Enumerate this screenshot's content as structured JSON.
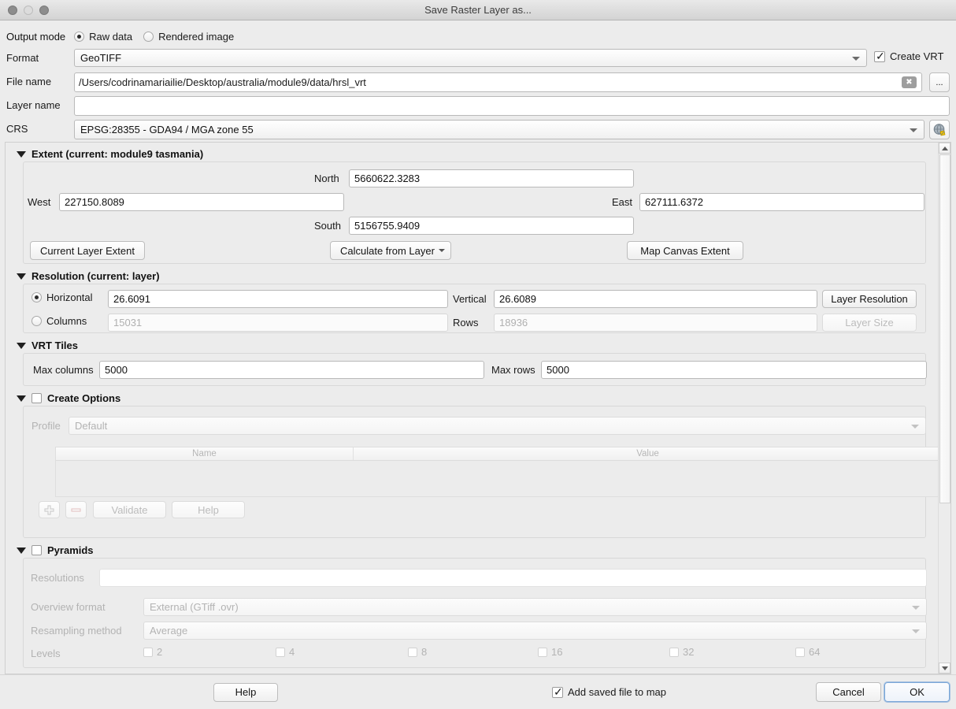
{
  "window": {
    "title": "Save Raster Layer as...",
    "controls": [
      "close",
      "minimize",
      "zoom"
    ]
  },
  "header": {
    "output_mode_label": "Output mode",
    "output_modes": [
      {
        "label": "Raw data",
        "selected": true
      },
      {
        "label": "Rendered image",
        "selected": false
      }
    ],
    "format_label": "Format",
    "format_value": "GeoTIFF",
    "create_vrt_label": "Create VRT",
    "create_vrt_checked": true,
    "file_name_label": "File name",
    "file_name_value": "/Users/codrinamariailie/Desktop/australia/module9/data/hrsl_vrt",
    "clear_icon": "clear-icon",
    "browse_label": "...",
    "layer_name_label": "Layer name",
    "layer_name_value": "",
    "crs_label": "CRS",
    "crs_value": "EPSG:28355 - GDA94 / MGA zone 55",
    "crs_select_icon": "globe-icon"
  },
  "extent": {
    "title": "Extent (current: module9 tasmania)",
    "north_label": "North",
    "north_value": "5660622.3283",
    "west_label": "West",
    "west_value": "227150.8089",
    "east_label": "East",
    "east_value": "627111.6372",
    "south_label": "South",
    "south_value": "5156755.9409",
    "current_layer_extent_label": "Current Layer Extent",
    "calculate_from_layer_label": "Calculate from Layer",
    "map_canvas_extent_label": "Map Canvas Extent"
  },
  "resolution": {
    "title": "Resolution (current: layer)",
    "horizontal_label": "Horizontal",
    "horizontal_value": "26.6091",
    "horizontal_selected": true,
    "vertical_label": "Vertical",
    "vertical_value": "26.6089",
    "columns_label": "Columns",
    "columns_value": "15031",
    "columns_selected": false,
    "rows_label": "Rows",
    "rows_value": "18936",
    "layer_resolution_label": "Layer Resolution",
    "layer_size_label": "Layer Size"
  },
  "vrt_tiles": {
    "title": "VRT Tiles",
    "max_columns_label": "Max columns",
    "max_columns_value": "5000",
    "max_rows_label": "Max rows",
    "max_rows_value": "5000"
  },
  "create_options": {
    "title": "Create Options",
    "checked": false,
    "profile_label": "Profile",
    "profile_value": "Default",
    "table_headers": [
      "Name",
      "Value"
    ],
    "table_rows": [],
    "add_icon": "plus-icon",
    "remove_icon": "minus-icon",
    "validate_label": "Validate",
    "help_label": "Help"
  },
  "pyramids": {
    "title": "Pyramids",
    "checked": false,
    "resolutions_label": "Resolutions",
    "resolutions_value": "",
    "overview_format_label": "Overview format",
    "overview_format_value": "External (GTiff .ovr)",
    "resampling_method_label": "Resampling method",
    "resampling_method_value": "Average",
    "levels_label": "Levels",
    "levels": [
      {
        "label": "2",
        "checked": false
      },
      {
        "label": "4",
        "checked": false
      },
      {
        "label": "8",
        "checked": false
      },
      {
        "label": "16",
        "checked": false
      },
      {
        "label": "32",
        "checked": false
      },
      {
        "label": "64",
        "checked": false
      }
    ]
  },
  "footer": {
    "help_label": "Help",
    "add_saved_file_label": "Add saved file to map",
    "add_saved_file_checked": true,
    "cancel_label": "Cancel",
    "ok_label": "OK"
  },
  "colors": {
    "window_bg": "#ececec",
    "field_bg": "#ffffff",
    "accent": "#7aa7d8",
    "disabled_text": "#b3b3b3"
  }
}
